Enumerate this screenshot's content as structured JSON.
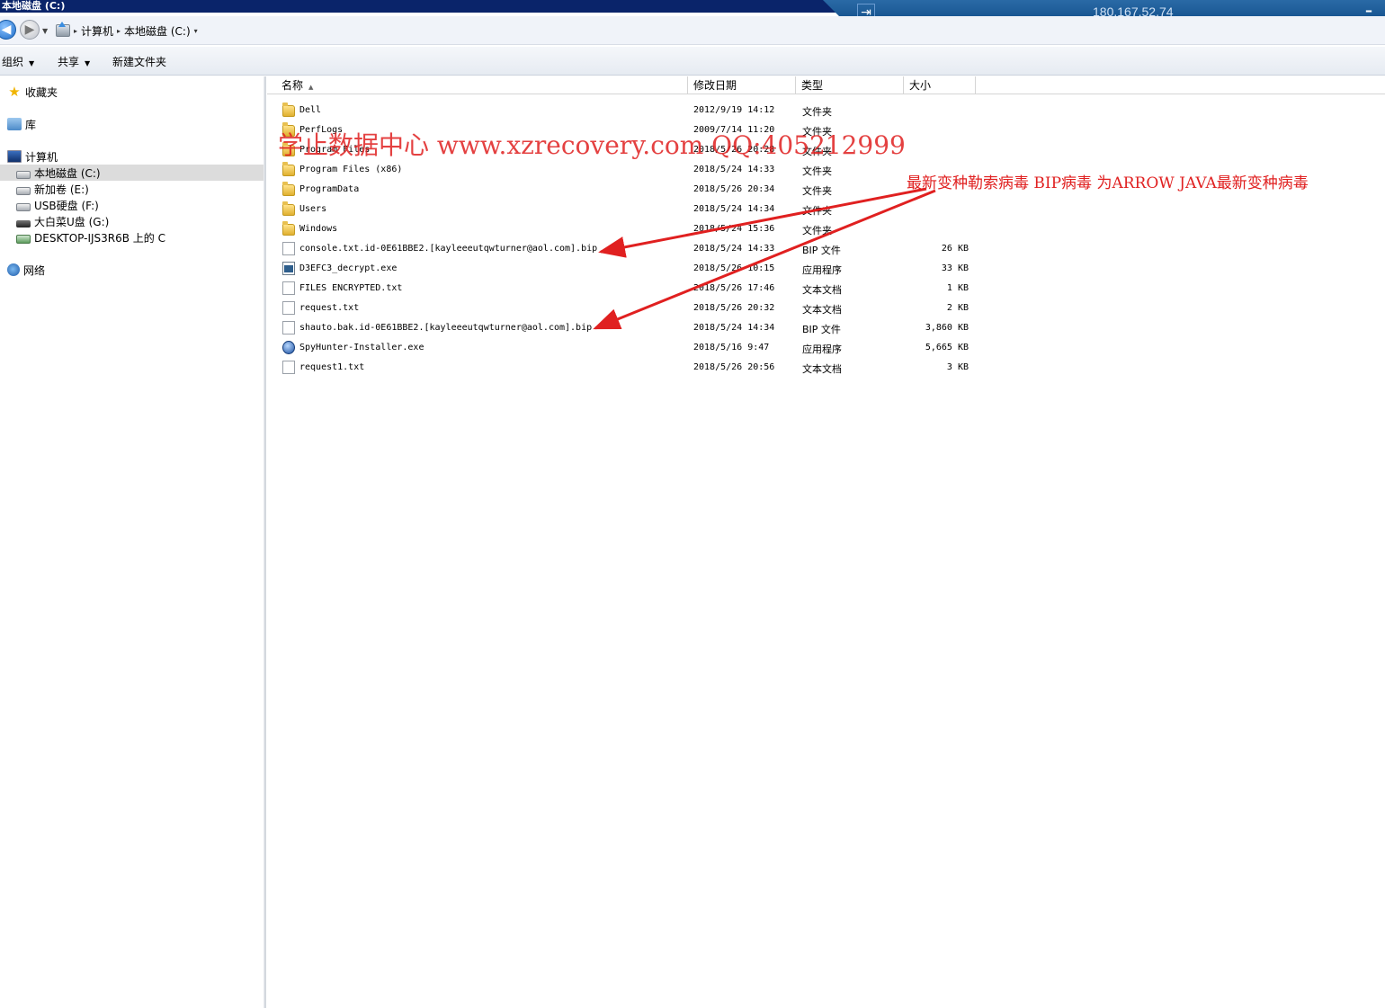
{
  "window": {
    "title": "本地磁盘 (C:)"
  },
  "remote": {
    "ip": "180.167.52.74"
  },
  "breadcrumb": {
    "items": [
      "计算机",
      "本地磁盘 (C:)"
    ]
  },
  "toolbar": {
    "organize": "组织",
    "share": "共享",
    "new_folder": "新建文件夹"
  },
  "sidebar": {
    "favorites": "收藏夹",
    "libraries": "库",
    "computer": "计算机",
    "drives": [
      {
        "label": "本地磁盘 (C:)",
        "icon": "drive-icon",
        "selected": true
      },
      {
        "label": "新加卷 (E:)",
        "icon": "drive-icon"
      },
      {
        "label": "USB硬盘 (F:)",
        "icon": "drive-icon"
      },
      {
        "label": "大白菜U盘 (G:)",
        "icon": "usb-drive-icon"
      },
      {
        "label": "DESKTOP-IJS3R6B 上的 C",
        "icon": "network-drive-icon"
      }
    ],
    "network": "网络"
  },
  "columns": {
    "name": "名称",
    "date": "修改日期",
    "type": "类型",
    "size": "大小"
  },
  "files": [
    {
      "name": "Dell",
      "date": "2012/9/19 14:12",
      "type": "文件夹",
      "size": "",
      "icon": "folder"
    },
    {
      "name": "PerfLogs",
      "date": "2009/7/14 11:20",
      "type": "文件夹",
      "size": "",
      "icon": "folder"
    },
    {
      "name": "Program Files",
      "date": "2018/5/26 20:28",
      "type": "文件夹",
      "size": "",
      "icon": "folder"
    },
    {
      "name": "Program Files (x86)",
      "date": "2018/5/24 14:33",
      "type": "文件夹",
      "size": "",
      "icon": "folder"
    },
    {
      "name": "ProgramData",
      "date": "2018/5/26 20:34",
      "type": "文件夹",
      "size": "",
      "icon": "folder"
    },
    {
      "name": "Users",
      "date": "2018/5/24 14:34",
      "type": "文件夹",
      "size": "",
      "icon": "folder"
    },
    {
      "name": "Windows",
      "date": "2018/5/24 15:36",
      "type": "文件夹",
      "size": "",
      "icon": "folder"
    },
    {
      "name": "console.txt.id-0E61BBE2.[kayleeeutqwturner@aol.com].bip",
      "date": "2018/5/24 14:33",
      "type": "BIP 文件",
      "size": "26 KB",
      "icon": "doc"
    },
    {
      "name": "D3EFC3_decrypt.exe",
      "date": "2018/5/26 10:15",
      "type": "应用程序",
      "size": "33 KB",
      "icon": "exe"
    },
    {
      "name": "FILES ENCRYPTED.txt",
      "date": "2018/5/26 17:46",
      "type": "文本文档",
      "size": "1 KB",
      "icon": "doc"
    },
    {
      "name": "request.txt",
      "date": "2018/5/26 20:32",
      "type": "文本文档",
      "size": "2 KB",
      "icon": "doc"
    },
    {
      "name": "shauto.bak.id-0E61BBE2.[kayleeeutqwturner@aol.com].bip",
      "date": "2018/5/24 14:34",
      "type": "BIP 文件",
      "size": "3,860 KB",
      "icon": "doc"
    },
    {
      "name": "SpyHunter-Installer.exe",
      "date": "2018/5/16 9:47",
      "type": "应用程序",
      "size": "5,665 KB",
      "icon": "globe"
    },
    {
      "name": "request1.txt",
      "date": "2018/5/26 20:56",
      "type": "文本文档",
      "size": "3 KB",
      "icon": "doc"
    }
  ],
  "overlay": {
    "watermark": "学止数据中心 www.xzrecovery.com QQ:405212999",
    "annotation": "最新变种勒索病毒 BIP病毒 为ARROW JAVA最新变种病毒",
    "color": "#e02020"
  }
}
